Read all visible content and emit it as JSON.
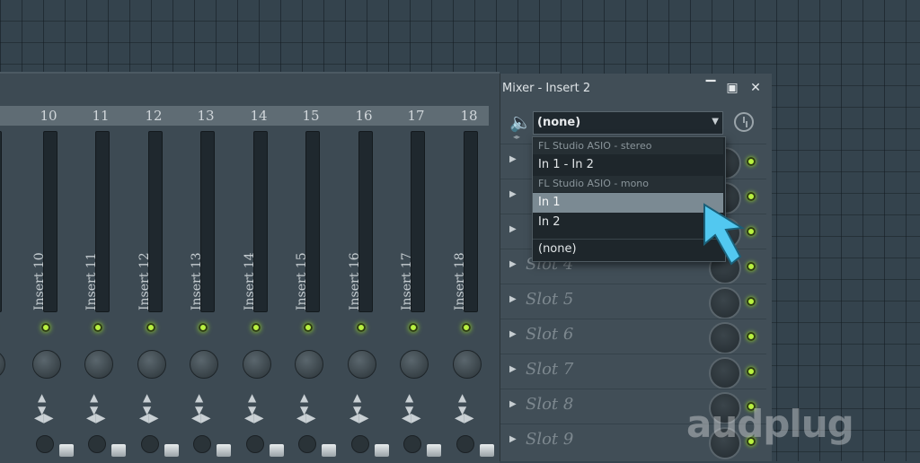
{
  "window": {
    "title": "Mixer - Insert 2"
  },
  "strips": [
    {
      "num": "10",
      "label": "Insert 10"
    },
    {
      "num": "11",
      "label": "Insert 11"
    },
    {
      "num": "12",
      "label": "Insert 12"
    },
    {
      "num": "13",
      "label": "Insert 13"
    },
    {
      "num": "14",
      "label": "Insert 14"
    },
    {
      "num": "15",
      "label": "Insert 15"
    },
    {
      "num": "16",
      "label": "Insert 16"
    },
    {
      "num": "17",
      "label": "Insert 17"
    },
    {
      "num": "18",
      "label": "Insert 18"
    }
  ],
  "input": {
    "selected": "(none)"
  },
  "dropdown": {
    "groups": [
      "FL Studio ASIO - stereo",
      "FL Studio ASIO - mono"
    ],
    "items": [
      "In 1 - In 2",
      "In 1",
      "In 2",
      "(none)"
    ],
    "selected_item": "In 1"
  },
  "slots": [
    "Slot 4",
    "Slot 5",
    "Slot 6",
    "Slot 7",
    "Slot 8",
    "Slot 9"
  ],
  "watermark": "audplug",
  "colors": {
    "accent_led": "#b8f040",
    "selection": "#7b8a93",
    "cursor": "#52c8f0"
  }
}
